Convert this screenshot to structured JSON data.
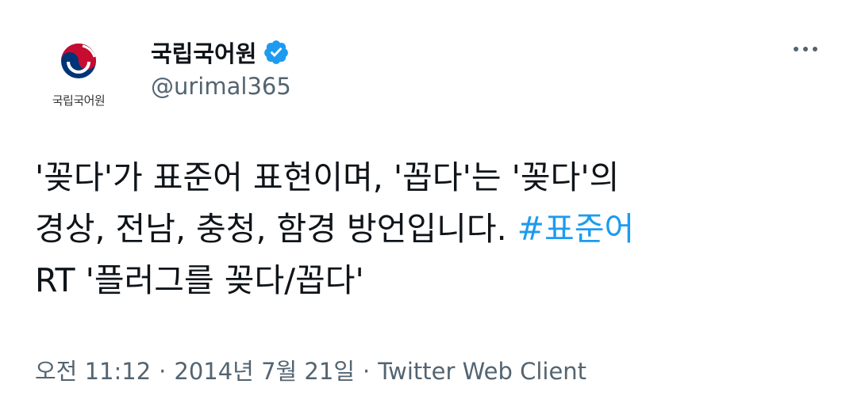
{
  "author": {
    "display_name": "국립국어원",
    "handle": "@urimal365",
    "avatar_caption": "국립국어원",
    "verified_icon": "verified-badge-icon",
    "verified_color": "#1d9bf0"
  },
  "tweet": {
    "line1": "'꽂다'가 표준어 표현이며, '꼽다'는 '꽂다'의",
    "line2_text": "경상, 전남, 충청, 함경 방언입니다. ",
    "hashtag": "#표준어",
    "line3": "RT '플러그를 꽂다/꼽다'",
    "hashtag_color": "#1d9bf0"
  },
  "meta": {
    "time": "오전 11:12",
    "separator": "·",
    "date": "2014년 7월 21일",
    "client": "Twitter Web Client"
  },
  "icons": {
    "more": "more-options-icon",
    "logo": "taegeuk-logo-icon"
  }
}
